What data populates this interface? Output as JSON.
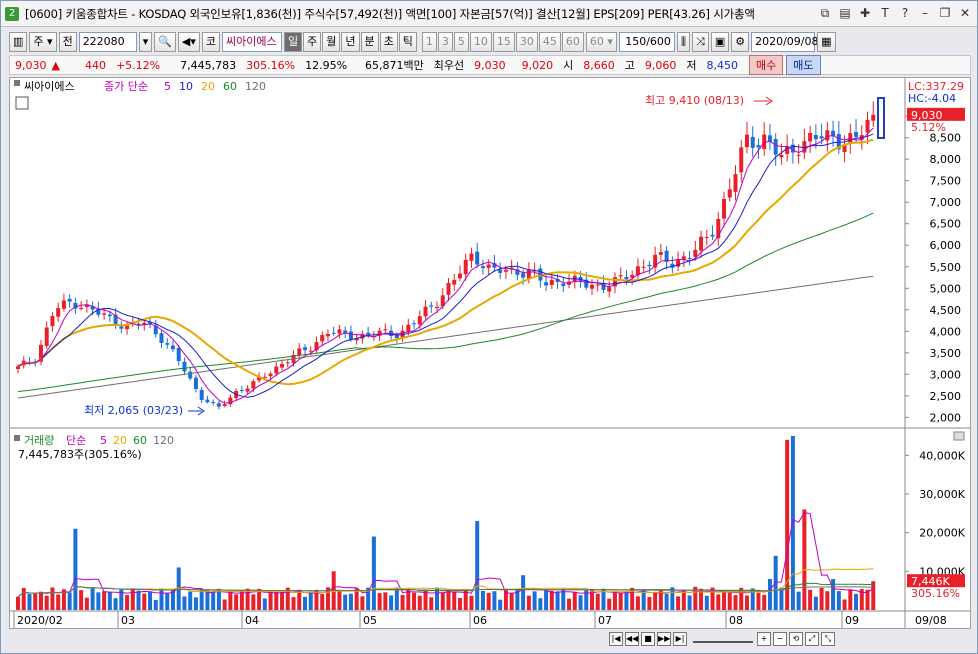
{
  "window": {
    "badge": "2",
    "title": "[0600] 키움종합차트 - KOSDAQ 외국인보유[1,836(천)] 주식수[57,492(천)] 액면[100] 자본금[57(억)] 결산[12월] EPS[209] PER[43.26] 시가총액"
  },
  "toolbar": {
    "type_label": "주",
    "prev_label": "전",
    "code": "222080",
    "market_label": "코",
    "stock_name": "씨아이에스",
    "periods": [
      "일",
      "주",
      "월",
      "년",
      "분",
      "초",
      "틱"
    ],
    "selected_period": "일",
    "intervals": [
      "1",
      "3",
      "5",
      "10",
      "15",
      "30",
      "45",
      "60"
    ],
    "interval_select": "60",
    "count": "150/600",
    "date": "2020/09/08"
  },
  "quote": {
    "price": "9,030",
    "arrow": "▲",
    "change": "440",
    "change_pct": "+5.12%",
    "volume": "7,445,783",
    "vol_ratio": "305.16%",
    "turnover": "12.95%",
    "amount": "65,871백만",
    "pref_label": "최우선",
    "ask": "9,030",
    "bid": "9,020",
    "open_label": "시",
    "open": "8,660",
    "high_label": "고",
    "high": "9,060",
    "low_label": "저",
    "low": "8,450",
    "buy_label": "매수",
    "sell_label": "매도"
  },
  "price_panel": {
    "stock_tag": "씨아이에스",
    "legend_prefix": "종가 단순",
    "ma_labels": [
      "5",
      "10",
      "20",
      "60",
      "120"
    ],
    "lc_label": "LC:337.29",
    "hc_label": "HC:-4.04",
    "last_price": "9,030",
    "last_pct": "5.12%",
    "high_note": "최고 9,410 (08/13)",
    "low_note": "최저 2,065 (03/23)",
    "y_ticks": [
      "9,000",
      "8,500",
      "8,000",
      "7,500",
      "7,000",
      "6,500",
      "6,000",
      "5,500",
      "5,000",
      "4,500",
      "4,000",
      "3,500",
      "3,000",
      "2,500",
      "2,000"
    ]
  },
  "volume_panel": {
    "title": "거래량",
    "legend_prefix": "단순",
    "ma_labels": [
      "5",
      "20",
      "60",
      "120"
    ],
    "readout": "7,445,783주(305.16%)",
    "last_value": "7,446K",
    "last_pct": "305.16%",
    "y_ticks": [
      "40,000K",
      "30,000K",
      "20,000K",
      "10,000K"
    ]
  },
  "x_axis": {
    "labels": [
      "2020/02",
      "03",
      "04",
      "05",
      "06",
      "07",
      "08",
      "09"
    ],
    "end_label": "09/08"
  },
  "colors": {
    "up": "#e8202a",
    "down": "#1a6fd8",
    "ma5": "#c000c0",
    "ma10": "#1c1cc8",
    "ma20": "#e8a800",
    "ma60": "#1a8a2a",
    "ma120": "#707070"
  },
  "chart_data": {
    "type": "candlestick",
    "x_range": [
      "2020/02",
      "2020/09/08"
    ],
    "price_range": [
      1800,
      9700
    ],
    "volume_range": [
      0,
      45000000
    ],
    "price_anchor_series": {
      "name": "close",
      "points": [
        [
          "02/03",
          3150
        ],
        [
          "02/07",
          3400
        ],
        [
          "02/12",
          4500
        ],
        [
          "02/17",
          4700
        ],
        [
          "02/21",
          4500
        ],
        [
          "02/26",
          4300
        ],
        [
          "03/02",
          4100
        ],
        [
          "03/06",
          4200
        ],
        [
          "03/11",
          3800
        ],
        [
          "03/17",
          3200
        ],
        [
          "03/20",
          2500
        ],
        [
          "03/23",
          2200
        ],
        [
          "03/27",
          2600
        ],
        [
          "04/02",
          2800
        ],
        [
          "04/08",
          3100
        ],
        [
          "04/14",
          3400
        ],
        [
          "04/20",
          3600
        ],
        [
          "04/24",
          4000
        ],
        [
          "04/29",
          3900
        ],
        [
          "05/06",
          3900
        ],
        [
          "05/12",
          3950
        ],
        [
          "05/18",
          3950
        ],
        [
          "05/22",
          4300
        ],
        [
          "05/27",
          4700
        ],
        [
          "06/01",
          5200
        ],
        [
          "06/04",
          5800
        ],
        [
          "06/09",
          5400
        ],
        [
          "06/15",
          5400
        ],
        [
          "06/19",
          5400
        ],
        [
          "06/24",
          5100
        ],
        [
          "06/29",
          5200
        ],
        [
          "07/03",
          5100
        ],
        [
          "07/08",
          5050
        ],
        [
          "07/13",
          5150
        ],
        [
          "07/17",
          5450
        ],
        [
          "07/22",
          5700
        ],
        [
          "07/27",
          5600
        ],
        [
          "07/30",
          5800
        ],
        [
          "08/03",
          6200
        ],
        [
          "08/06",
          7200
        ],
        [
          "08/10",
          8400
        ],
        [
          "08/13",
          8500
        ],
        [
          "08/19",
          8000
        ],
        [
          "08/24",
          8400
        ],
        [
          "08/27",
          8500
        ],
        [
          "09/01",
          8500
        ],
        [
          "09/04",
          8400
        ],
        [
          "09/08",
          9030
        ]
      ]
    },
    "volume_anchor_series": {
      "name": "volume",
      "points": [
        [
          "02/12",
          21000000
        ],
        [
          "03/02",
          11000000
        ],
        [
          "04/20",
          16000000
        ],
        [
          "04/24",
          19000000
        ],
        [
          "05/20",
          23000000
        ],
        [
          "06/05",
          9000000
        ],
        [
          "07/15",
          5000000
        ],
        [
          "08/07",
          8000000
        ],
        [
          "08/11",
          44000000
        ],
        [
          "08/13",
          45000000
        ],
        [
          "08/14",
          26000000
        ],
        [
          "09/08",
          7445783
        ]
      ]
    }
  }
}
